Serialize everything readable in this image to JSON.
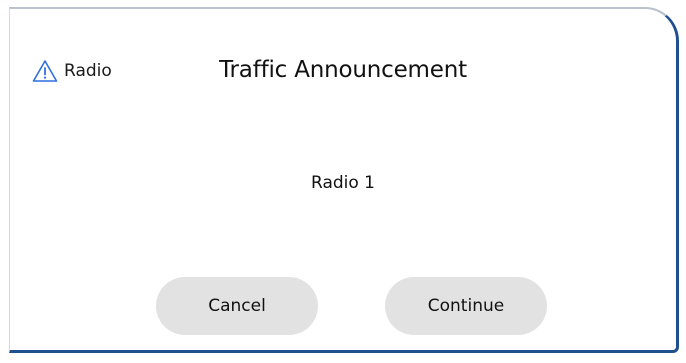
{
  "dialog": {
    "source_label": "Radio",
    "title": "Traffic Announcement",
    "station": "Radio 1",
    "warning_icon": "warning-triangle-icon",
    "cancel_label": "Cancel",
    "continue_label": "Continue"
  },
  "colors": {
    "accent_border": "#1f4f8f",
    "warning_icon": "#2f6fe0",
    "button_bg": "#e2e2e2"
  }
}
